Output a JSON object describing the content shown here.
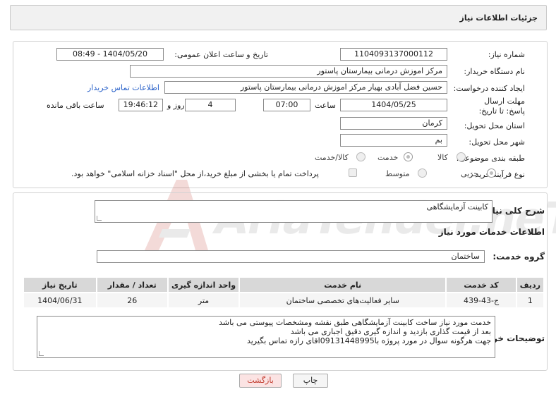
{
  "header": {
    "title": "جزئیات اطلاعات نیاز"
  },
  "form": {
    "need_number": {
      "label": "شماره نیاز:",
      "value": "1104093137000112"
    },
    "announce_datetime": {
      "label": "تاریخ و ساعت اعلان عمومی:",
      "value": "1404/05/20 - 08:49"
    },
    "buyer_org": {
      "label": "نام دستگاه خریدار:",
      "value": "مرکز اموزش درمانی بیمارستان پاستور"
    },
    "requester": {
      "label": "ایجاد کننده درخواست:",
      "value": "حسین فضل آبادی بهیار مرکز اموزش درمانی بیمارستان پاستور"
    },
    "buyer_contact_link": "اطلاعات تماس خریدار",
    "deadline": {
      "label": "مهلت ارسال پاسخ: تا تاریخ:",
      "date": "1404/05/25",
      "time_label": "ساعت",
      "time": "07:00",
      "days": "4",
      "days_label": "روز و",
      "remaining": "19:46:12",
      "remaining_label": "ساعت باقی مانده"
    },
    "province": {
      "label": "استان محل تحویل:",
      "value": "کرمان"
    },
    "city": {
      "label": "شهر محل تحویل:",
      "value": "بم"
    },
    "category": {
      "label": "طبقه بندی موضوعی:",
      "options": [
        "کالا",
        "خدمت",
        "کالا/خدمت"
      ],
      "selected": "خدمت"
    },
    "purchase_type": {
      "label": "نوع فرآیند خرید :",
      "options": [
        "جزیی",
        "متوسط"
      ],
      "selected": "جزیی",
      "payment_note": "پرداخت تمام یا بخشی از مبلغ خرید،از محل \"اسناد خزانه اسلامی\" خواهد بود."
    }
  },
  "summary": {
    "label": "شرح کلی نیاز:",
    "value": "کابینت آزمایشگاهی"
  },
  "services": {
    "title": "اطلاعات خدمات مورد نیاز",
    "group_label": "گروه خدمت:",
    "group_value": "ساختمان",
    "columns": [
      "ردیف",
      "کد خدمت",
      "نام خدمت",
      "واحد اندازه گیری",
      "تعداد / مقدار",
      "تاریخ نیاز"
    ],
    "rows": [
      [
        "1",
        "ج-43-439",
        "سایر فعالیت‌های تخصصی ساختمان",
        "متر",
        "26",
        "1404/06/31"
      ]
    ]
  },
  "buyer_notes": {
    "label": "توضیحات خریدار:",
    "lines": [
      "خدمت مورد نیاز ساخت کابینت آزمایشگاهی طبق نقشه ومشخصات پیوستی می باشد",
      "بعد از قیمت گذاری بازدید و اندازه گیری دقیق اجباری  می باشد",
      "جهت هرگونه سوال در مورد پروژه با09131448995اقای رازه تماس بگیرید"
    ]
  },
  "buttons": {
    "print": "چاپ",
    "back": "بازگشت"
  },
  "colors": {
    "back_button_bg": "#fbe3e3",
    "back_button_text": "#c0392b",
    "link": "#2a62c9"
  },
  "watermark": "AriaTender.net"
}
